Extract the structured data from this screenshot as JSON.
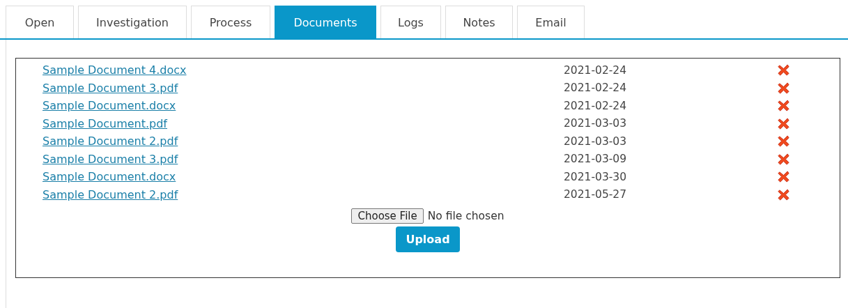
{
  "tabs": [
    {
      "label": "Open",
      "selected": false
    },
    {
      "label": "Investigation",
      "selected": false
    },
    {
      "label": "Process",
      "selected": false
    },
    {
      "label": "Documents",
      "selected": true
    },
    {
      "label": "Logs",
      "selected": false
    },
    {
      "label": "Notes",
      "selected": false
    },
    {
      "label": "Email",
      "selected": false
    }
  ],
  "documents": [
    {
      "name": "Sample Document 4.docx",
      "date": "2021-02-24"
    },
    {
      "name": "Sample Document 3.pdf",
      "date": "2021-02-24"
    },
    {
      "name": "Sample Document.docx",
      "date": "2021-02-24"
    },
    {
      "name": "Sample Document.pdf",
      "date": "2021-03-03"
    },
    {
      "name": "Sample Document 2.pdf",
      "date": "2021-03-03"
    },
    {
      "name": "Sample Document 3.pdf",
      "date": "2021-03-09"
    },
    {
      "name": "Sample Document.docx",
      "date": "2021-03-30"
    },
    {
      "name": "Sample Document 2.pdf",
      "date": "2021-05-27"
    }
  ],
  "file_input": {
    "button": "Choose File",
    "status": "No file chosen"
  },
  "upload_button": "Upload"
}
